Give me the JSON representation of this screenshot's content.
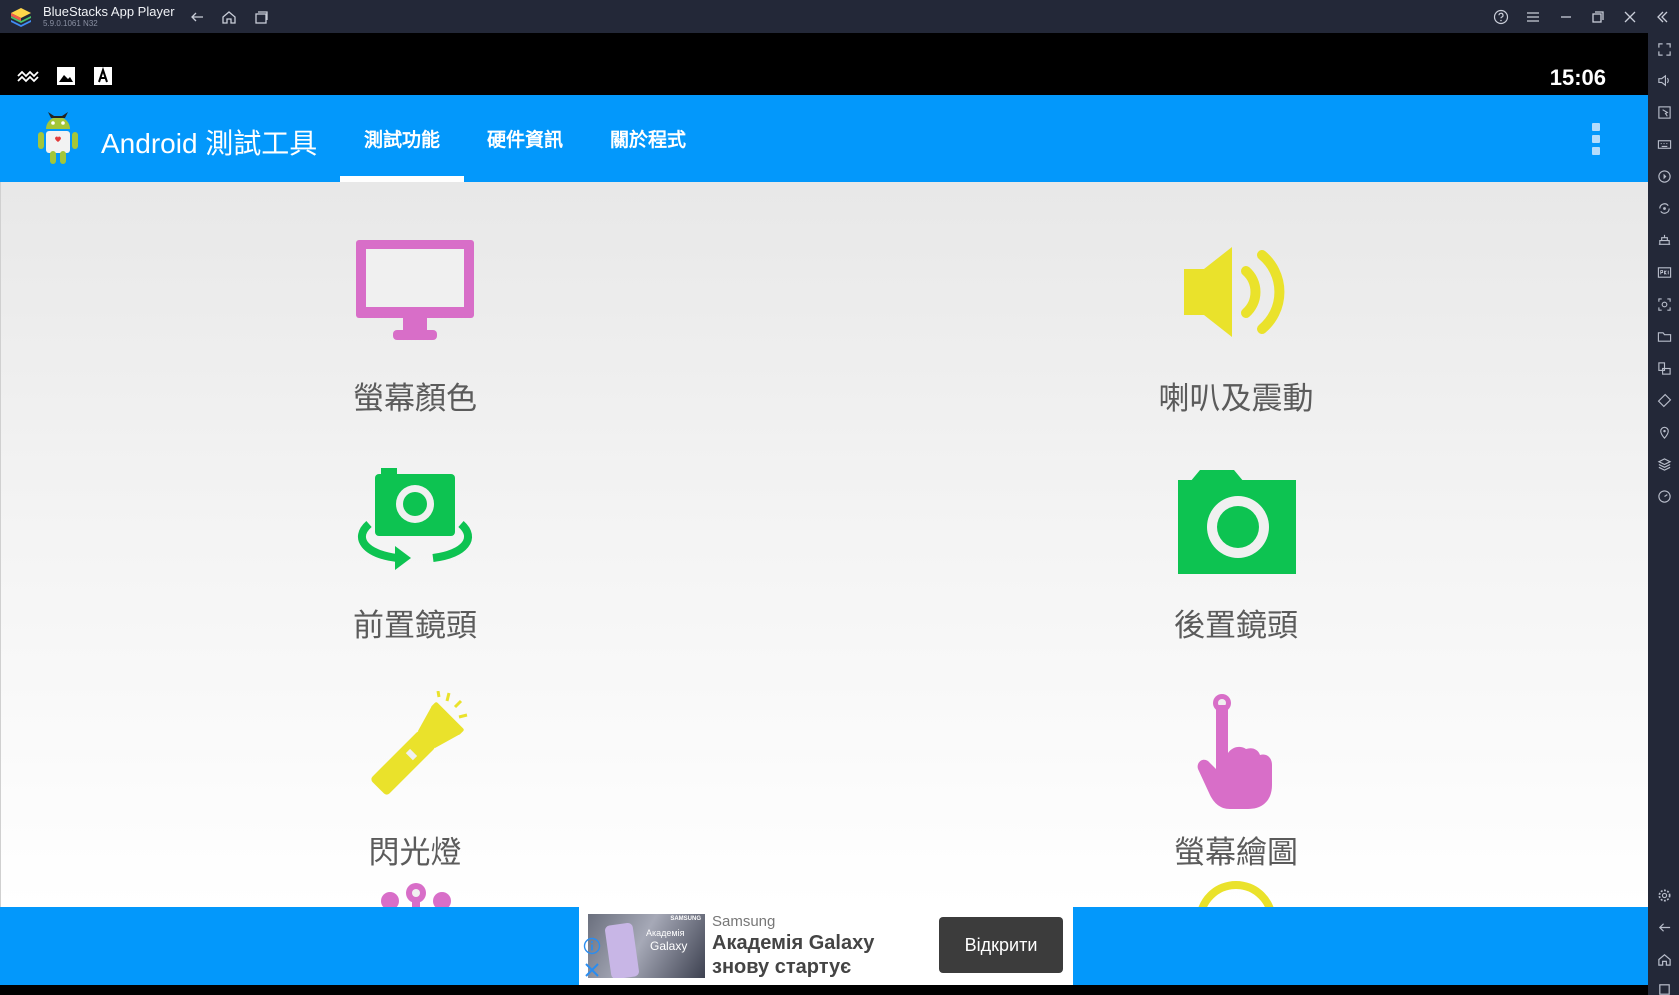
{
  "window": {
    "title": "BlueStacks App Player",
    "version": "5.9.0.1061 N32"
  },
  "status_bar": {
    "time": "15:06"
  },
  "app": {
    "title": "Android 測試工具",
    "tabs": [
      {
        "label": "測試功能",
        "selected": true
      },
      {
        "label": "硬件資訊",
        "selected": false
      },
      {
        "label": "關於程式",
        "selected": false
      }
    ]
  },
  "tests": [
    {
      "label": "螢幕顏色",
      "icon": "monitor-icon",
      "color": "#d86ec8"
    },
    {
      "label": "喇叭及震動",
      "icon": "speaker-icon",
      "color": "#eae22b"
    },
    {
      "label": "前置鏡頭",
      "icon": "front-camera-icon",
      "color": "#0dc351"
    },
    {
      "label": "後置鏡頭",
      "icon": "rear-camera-icon",
      "color": "#0dc351"
    },
    {
      "label": "閃光燈",
      "icon": "flashlight-icon",
      "color": "#eae22b"
    },
    {
      "label": "螢幕繪圖",
      "icon": "touch-hand-icon",
      "color": "#d86ec8"
    }
  ],
  "ad": {
    "advertiser": "Samsung",
    "headline": "Академія Galaxy знову стартує",
    "cta": "Відкрити",
    "image_brand": "SAMSUNG",
    "image_title_1": "Академія",
    "image_title_2": "Galaxy"
  },
  "colors": {
    "accent": "#0398fb",
    "pink": "#d86ec8",
    "yellow": "#eae22b",
    "green": "#0dc351"
  }
}
